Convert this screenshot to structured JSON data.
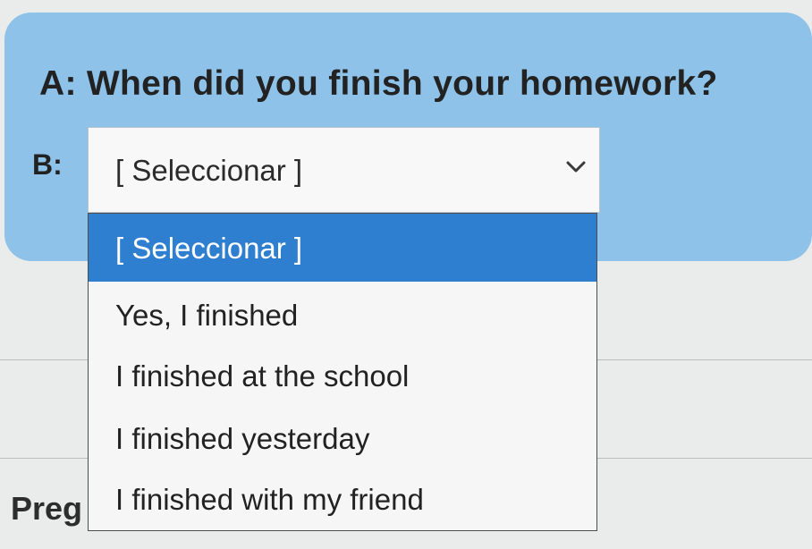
{
  "question": {
    "text": "A: When did you finish your homework?"
  },
  "answer": {
    "label": "B:",
    "select": {
      "selected_value": "[ Seleccionar ]",
      "chevron_icon": "chevron-down-icon"
    }
  },
  "dropdown": {
    "options": [
      {
        "label": "[ Seleccionar ]",
        "selected": true
      },
      {
        "label": "Yes, I finished",
        "selected": false
      },
      {
        "label": "I finished at the school",
        "selected": false
      },
      {
        "label": "I finished yesterday",
        "selected": false
      },
      {
        "label": "I finished with my friend",
        "selected": false
      }
    ]
  },
  "footer": {
    "next_question_label": "Preg"
  },
  "colors": {
    "panel_background": "#8fc2e8",
    "selected_option_background": "#2f7fd0",
    "page_background": "#e9ecea"
  }
}
